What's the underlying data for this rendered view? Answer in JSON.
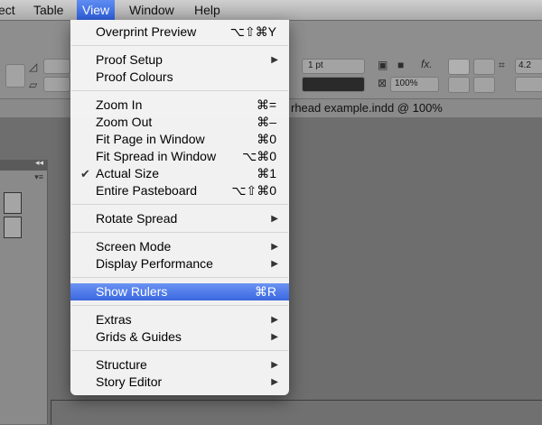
{
  "menubar": {
    "items": [
      "ect",
      "Table",
      "View",
      "Window",
      "Help"
    ]
  },
  "control_panel": {
    "stroke_weight": "1 pt",
    "zoom": "100%",
    "fx_label": "fx.",
    "partial_value": "4.2"
  },
  "document": {
    "tab_title": "rhead example.indd @ 100%"
  },
  "view_menu": {
    "overprint_preview": {
      "label": "Overprint Preview",
      "shortcut": "⌥⇧⌘Y"
    },
    "proof_setup": {
      "label": "Proof Setup"
    },
    "proof_colours": {
      "label": "Proof Colours"
    },
    "zoom_in": {
      "label": "Zoom In",
      "shortcut": "⌘="
    },
    "zoom_out": {
      "label": "Zoom Out",
      "shortcut": "⌘–"
    },
    "fit_page": {
      "label": "Fit Page in Window",
      "shortcut": "⌘0"
    },
    "fit_spread": {
      "label": "Fit Spread in Window",
      "shortcut": "⌥⌘0"
    },
    "actual_size": {
      "label": "Actual Size",
      "shortcut": "⌘1",
      "checked": true
    },
    "entire_pasteboard": {
      "label": "Entire Pasteboard",
      "shortcut": "⌥⇧⌘0"
    },
    "rotate_spread": {
      "label": "Rotate Spread"
    },
    "screen_mode": {
      "label": "Screen Mode"
    },
    "display_performance": {
      "label": "Display Performance"
    },
    "show_rulers": {
      "label": "Show Rulers",
      "shortcut": "⌘R",
      "highlighted": true
    },
    "extras": {
      "label": "Extras"
    },
    "grids_guides": {
      "label": "Grids & Guides"
    },
    "structure": {
      "label": "Structure"
    },
    "story_editor": {
      "label": "Story Editor"
    }
  },
  "icons": {
    "submenu": "triangle-right-icon",
    "check": "checkmark-icon"
  },
  "colors": {
    "highlight": "#3a67e0",
    "menu_bg": "#f4f4f4",
    "dim_bg": "#6e6e6e"
  }
}
